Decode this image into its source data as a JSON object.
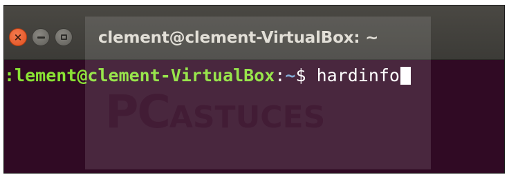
{
  "window": {
    "title": "clement@clement-VirtualBox: ~",
    "buttons": {
      "close_glyph": "×",
      "close_icon": "close-icon",
      "minimize_icon": "minimize-icon",
      "maximize_icon": "maximize-icon"
    }
  },
  "terminal": {
    "prompt_user": ":lement@clement-VirtualBox",
    "prompt_sep": ":",
    "prompt_path": "~",
    "prompt_dollar": "$ ",
    "command": "hardinfo"
  },
  "watermark": {
    "big": "PC",
    "small": "ASTUCES"
  },
  "colors": {
    "terminal_bg": "#300a24",
    "titlebar_bg": "#3c3b37",
    "prompt_user": "#8ae234",
    "prompt_path": "#729fcf",
    "close_button": "#e0501f"
  }
}
